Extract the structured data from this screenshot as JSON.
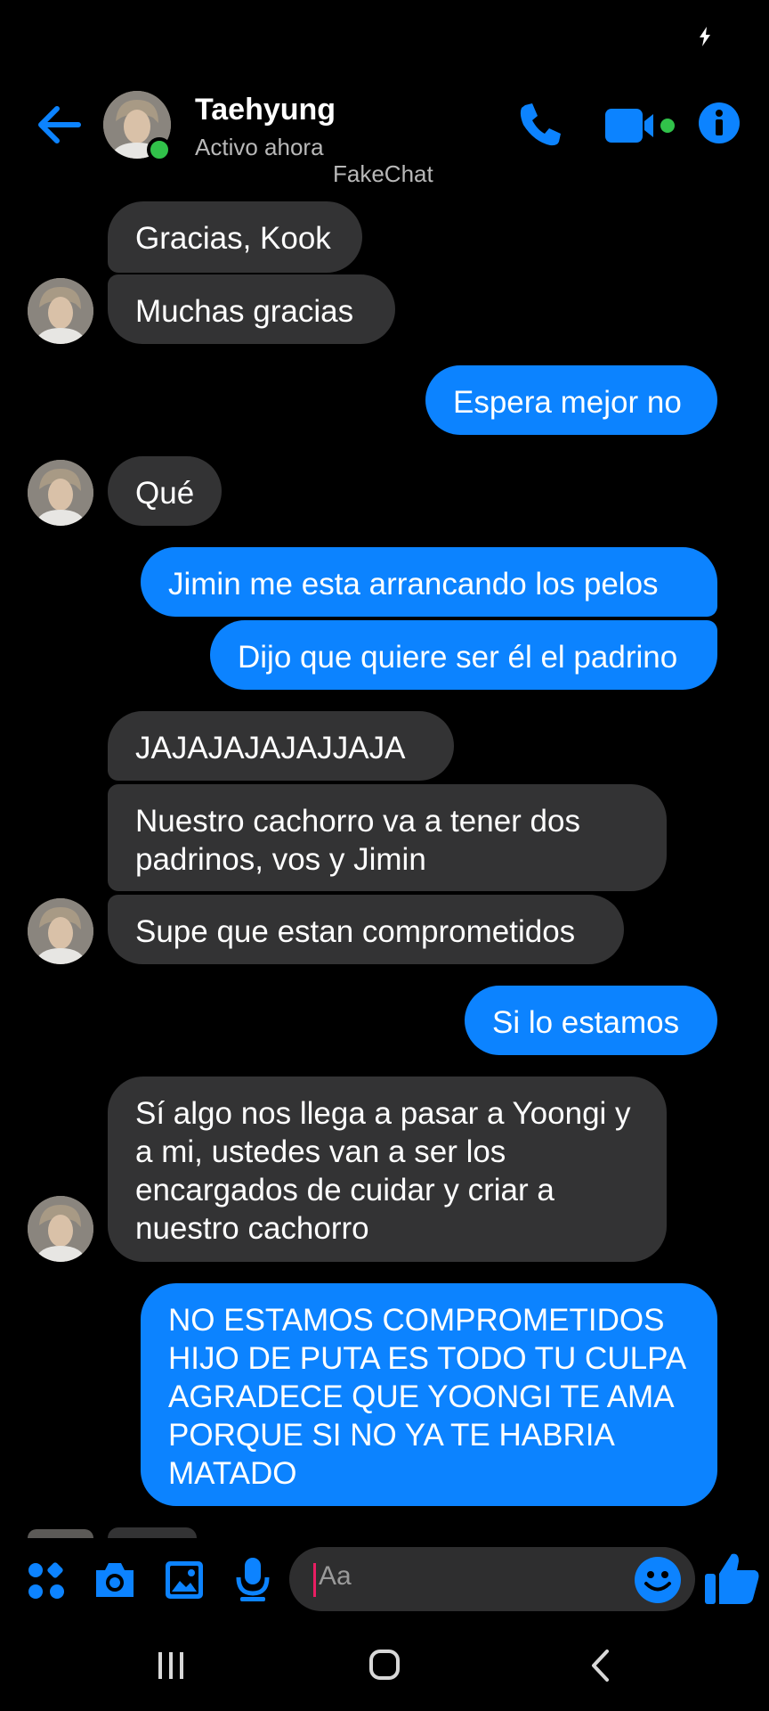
{
  "header": {
    "contact_name": "Taehyung",
    "presence": "Activo ahora",
    "watermark": "FakeChat"
  },
  "messages": [
    {
      "from": "them",
      "text": "Gracias, Kook"
    },
    {
      "from": "them",
      "text": "Muchas gracias"
    },
    {
      "from": "me",
      "text": "Espera mejor no"
    },
    {
      "from": "them",
      "text": "Qué"
    },
    {
      "from": "me",
      "text": "Jimin me esta arrancando los pelos"
    },
    {
      "from": "me",
      "text": "Dijo que quiere ser él el padrino"
    },
    {
      "from": "them",
      "text": "JAJAJAJAJAJJAJA"
    },
    {
      "from": "them",
      "text": "Nuestro cachorro va a tener dos padrinos, vos y Jimin"
    },
    {
      "from": "them",
      "text": "Supe que estan comprometidos"
    },
    {
      "from": "me",
      "text": "Si lo estamos"
    },
    {
      "from": "them",
      "text": "Sí algo nos llega a pasar a Yoongi y a mi, ustedes van a ser los encargados de cuidar y criar a nuestro cachorro"
    },
    {
      "from": "me",
      "text": "NO ESTAMOS COMPROMETIDOS HIJO DE PUTA ES TODO TU CULPA AGRADECE QUE YOONGI TE AMA PORQUE SI NO YA TE HABRIA MATADO"
    }
  ],
  "composer": {
    "placeholder": "Aa",
    "tools": [
      "apps-icon",
      "camera-icon",
      "gallery-icon",
      "microphone-icon"
    ],
    "emoji_icon": "emoji-icon",
    "send_icon": "thumbs-up-icon"
  },
  "colors": {
    "accent": "#0c83ff",
    "incoming_bubble": "#333334",
    "online": "#31c24a"
  }
}
